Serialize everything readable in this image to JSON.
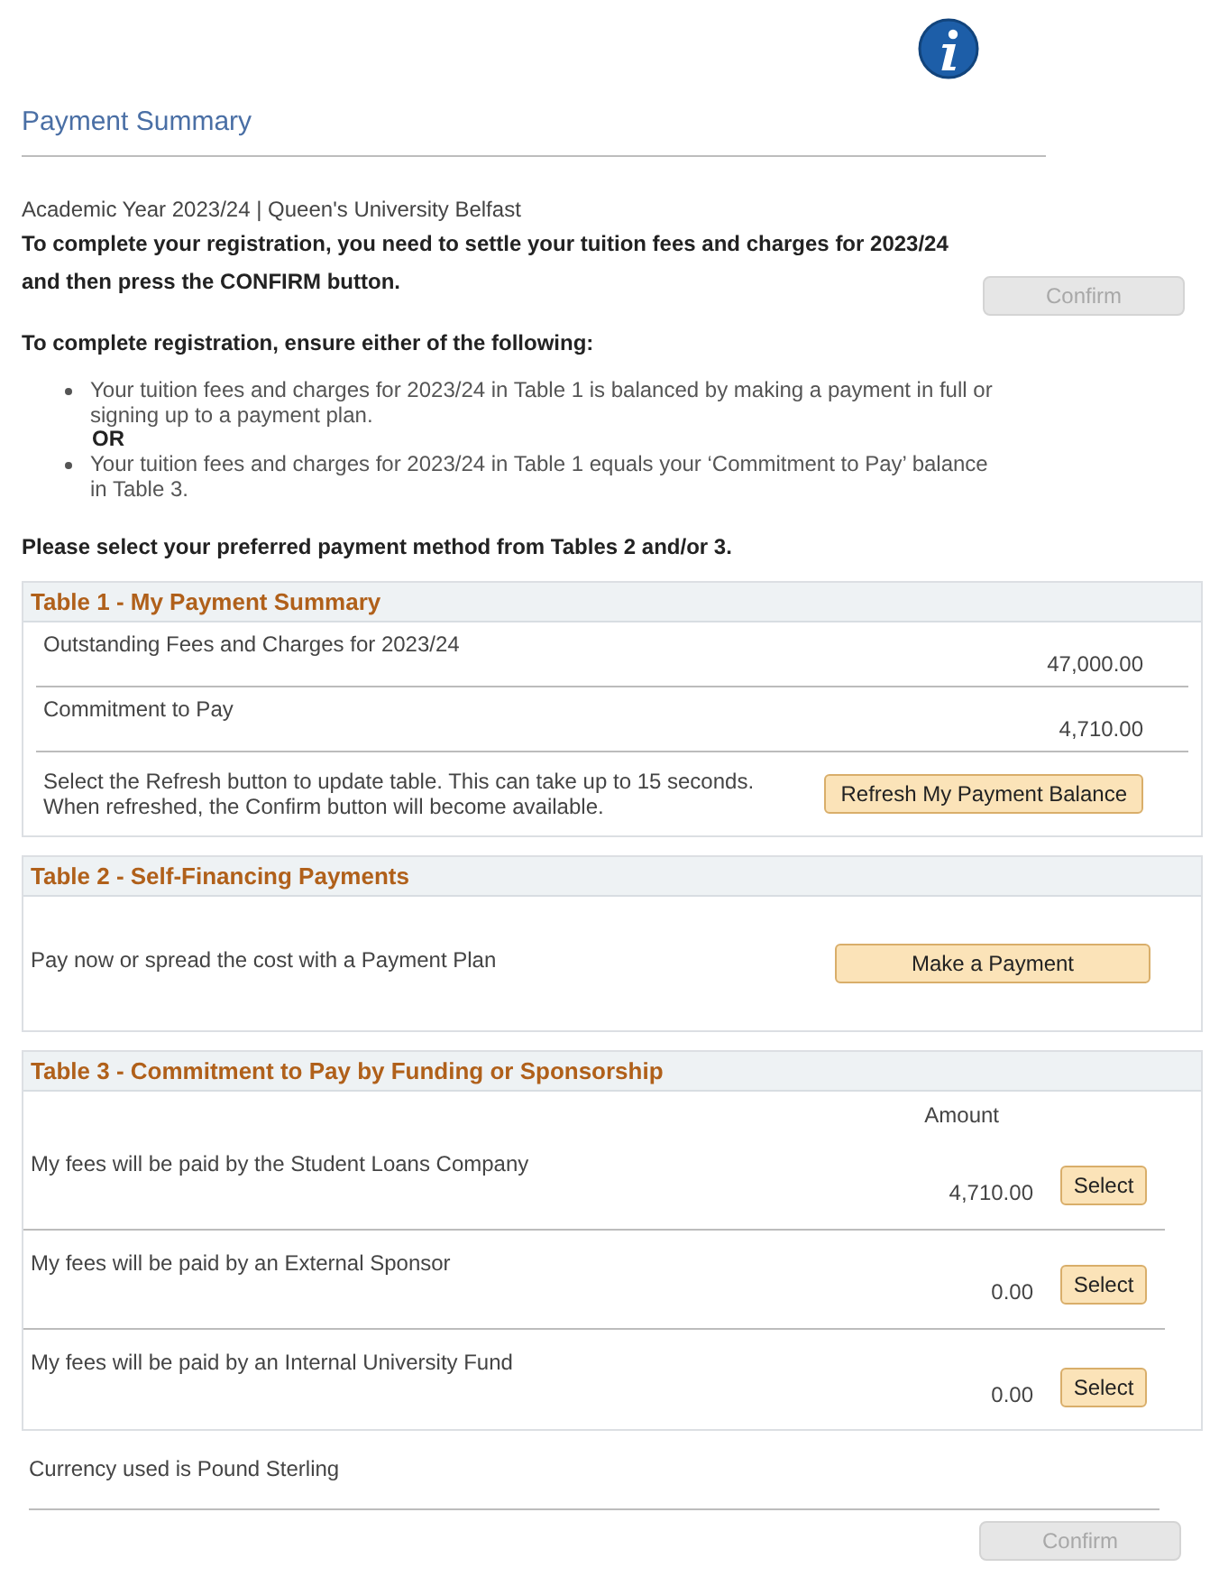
{
  "page_title": "Payment Summary",
  "subtitle": "Academic Year 2023/24 | Queen's University Belfast",
  "instruction_lines": [
    "To complete your registration, you need to settle your tuition fees and charges for 2023/24",
    "and then press the CONFIRM button."
  ],
  "confirm_top": {
    "label": "Confirm",
    "disabled": true
  },
  "ensure_heading": "To complete registration, ensure either of the following:",
  "bullets": [
    "Your tuition fees and charges for 2023/24 in Table 1 is balanced by making a payment in full or signing up to a payment plan.",
    "Your tuition fees and charges for 2023/24 in Table 1 equals your ‘Commitment to Pay’ balance in Table 3."
  ],
  "or_label": "OR",
  "select_prompt": "Please select your preferred payment method from Tables 2 and/or 3.",
  "table1": {
    "title": "Table 1 - My Payment Summary",
    "rows": [
      {
        "label": "Outstanding Fees and Charges for 2023/24",
        "amount": "47,000.00"
      },
      {
        "label": "Commitment to Pay",
        "amount": "4,710.00"
      }
    ],
    "refresh_lines": [
      "Select the Refresh button to update table. This can take up to 15 seconds.",
      "When refreshed, the Confirm button will become available."
    ],
    "refresh_button": "Refresh My Payment Balance"
  },
  "table2": {
    "title": "Table 2 - Self-Financing Payments",
    "text": "Pay now or spread the cost with a Payment Plan",
    "button": "Make a Payment"
  },
  "table3": {
    "title": "Table 3 - Commitment to Pay by Funding or Sponsorship",
    "amount_header": "Amount",
    "rows": [
      {
        "label": "My fees will be paid by the Student Loans Company",
        "amount": "4,710.00",
        "button": "Select"
      },
      {
        "label": "My fees will be paid by an External Sponsor",
        "amount": "0.00",
        "button": "Select"
      },
      {
        "label": "My fees will be paid by an Internal University Fund",
        "amount": "0.00",
        "button": "Select"
      }
    ]
  },
  "currency_note": "Currency used is Pound Sterling",
  "confirm_bottom": {
    "label": "Confirm",
    "disabled": true
  }
}
